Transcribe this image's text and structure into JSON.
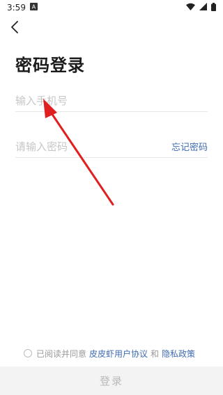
{
  "status_bar": {
    "time": "3:59",
    "icons": [
      "notification-a-icon",
      "wifi-icon",
      "signal-icon",
      "battery-icon"
    ]
  },
  "nav": {
    "back_icon": "chevron-left-icon"
  },
  "page": {
    "title": "密码登录"
  },
  "form": {
    "phone_placeholder": "输入手机号",
    "password_placeholder": "请输入密码",
    "forgot_label": "忘记密码"
  },
  "agreement": {
    "prefix": "已阅读并同意",
    "user_agreement": "皮皮虾用户协议",
    "conjunction": "和",
    "privacy_policy": "隐私政策"
  },
  "login_button": {
    "label": "登录"
  },
  "colors": {
    "link": "#3f6bb1",
    "annotation_arrow": "#e02020",
    "button_bg": "#f3f3f3"
  }
}
